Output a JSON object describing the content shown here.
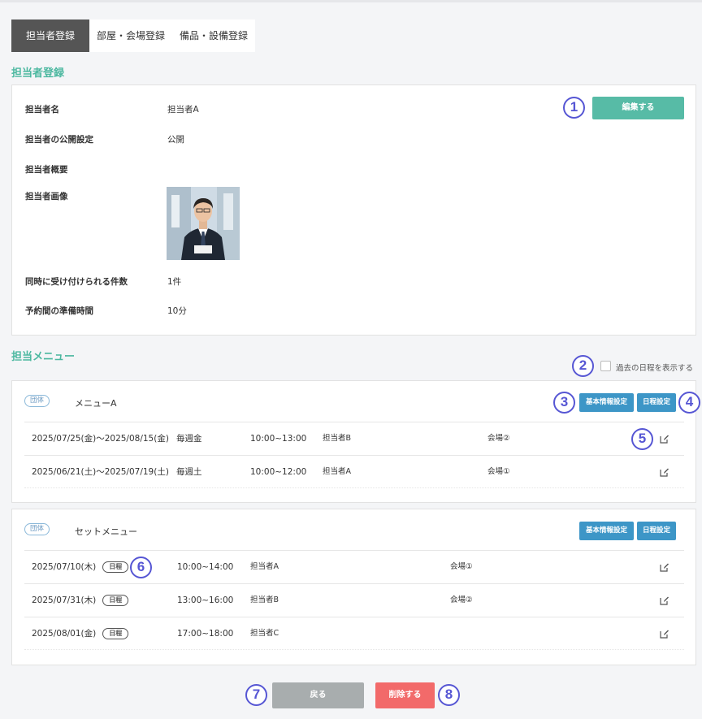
{
  "tabs": [
    {
      "label": "担当者登録",
      "active": true
    },
    {
      "label": "部屋・会場登録",
      "active": false
    },
    {
      "label": "備品・設備登録",
      "active": false
    }
  ],
  "staff_section": {
    "title": "担当者登録",
    "edit_button": "編集する",
    "fields": {
      "name": {
        "label": "担当者名",
        "value": "担当者A"
      },
      "visibility": {
        "label": "担当者の公開設定",
        "value": "公開"
      },
      "summary": {
        "label": "担当者概要",
        "value": ""
      },
      "image": {
        "label": "担当者画像"
      },
      "concurrent": {
        "label": "同時に受け付けられる件数",
        "value": "1件"
      },
      "prep_time": {
        "label": "予約間の準備時間",
        "value": "10分"
      }
    }
  },
  "menu_section": {
    "title": "担当メニュー",
    "show_past_label": "過去の日程を表示する",
    "show_past_checked": false,
    "buttons": {
      "basic": "基本情報設定",
      "schedule": "日程設定"
    },
    "menus": [
      {
        "badge": "団体",
        "name": "メニューA",
        "rows": [
          {
            "date": "2025/07/25(金)～2025/08/15(金)",
            "recurrence": "毎週金",
            "time": "10:00~13:00",
            "staff": "担当者B",
            "venue": "会場②"
          },
          {
            "date": "2025/06/21(土)～2025/07/19(土)",
            "recurrence": "毎週土",
            "time": "10:00~12:00",
            "staff": "担当者A",
            "venue": "会場①"
          }
        ]
      },
      {
        "badge": "団体",
        "name": "セットメニュー",
        "rows": [
          {
            "date": "2025/07/10(木)",
            "tag": "日程",
            "time": "10:00~14:00",
            "staff": "担当者A",
            "venue": "会場①"
          },
          {
            "date": "2025/07/31(木)",
            "tag": "日程",
            "time": "13:00~16:00",
            "staff": "担当者B",
            "venue": "会場②"
          },
          {
            "date": "2025/08/01(金)",
            "tag": "日程",
            "time": "17:00~18:00",
            "staff": "担当者C",
            "venue": ""
          }
        ]
      }
    ]
  },
  "footer": {
    "back_button": "戻る",
    "delete_button": "削除する"
  },
  "markers": [
    "1",
    "2",
    "3",
    "4",
    "5",
    "6",
    "7",
    "8"
  ],
  "colors": {
    "accent_green": "#57bba6",
    "title_green": "#4cb8a0",
    "button_blue": "#3d96c7",
    "delete_red": "#f26a6a",
    "back_gray": "#a8adae",
    "marker_purple": "#5656d4"
  }
}
